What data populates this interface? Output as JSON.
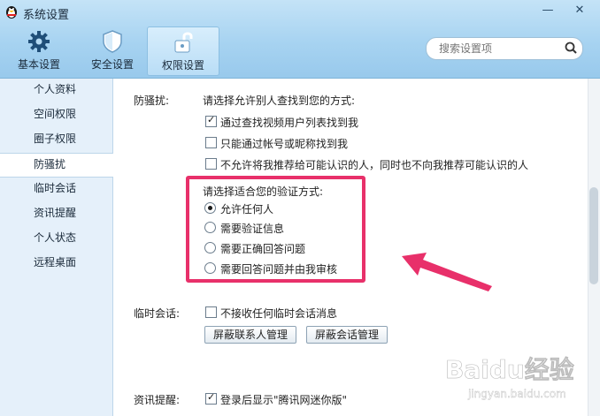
{
  "window": {
    "title": "系统设置"
  },
  "toolbar": {
    "tabs": [
      {
        "label": "基本设置",
        "icon": "gear-icon"
      },
      {
        "label": "安全设置",
        "icon": "shield-icon"
      },
      {
        "label": "权限设置",
        "icon": "unlock-icon",
        "active": true
      }
    ]
  },
  "search": {
    "placeholder": "搜索设置项"
  },
  "sidebar": {
    "items": [
      {
        "label": "个人资料"
      },
      {
        "label": "空间权限"
      },
      {
        "label": "圈子权限"
      },
      {
        "label": "防骚扰",
        "active": true
      },
      {
        "label": "临时会话"
      },
      {
        "label": "资讯提醒"
      },
      {
        "label": "个人状态"
      },
      {
        "label": "远程桌面"
      }
    ]
  },
  "anti_harass": {
    "label": "防骚扰:",
    "prompt": "请选择允许别人查找到您的方式:",
    "options": [
      {
        "label": "通过查找视频用户列表找到我",
        "checked": true
      },
      {
        "label": "只能通过帐号或昵称找到我",
        "checked": false
      },
      {
        "label": "不允许将我推荐给可能认识的人，同时也不向我推荐可能认识的人",
        "checked": false
      }
    ],
    "verify_prompt": "请选择适合您的验证方式:",
    "verify_options": [
      {
        "label": "允许任何人",
        "selected": true
      },
      {
        "label": "需要验证信息",
        "selected": false
      },
      {
        "label": "需要正确回答问题",
        "selected": false
      },
      {
        "label": "需要回答问题并由我审核",
        "selected": false
      }
    ]
  },
  "temp_session": {
    "label": "临时会话:",
    "option": {
      "label": "不接收任何临时会话消息",
      "checked": false
    },
    "buttons": [
      "屏蔽联系人管理",
      "屏蔽会话管理"
    ]
  },
  "news_reminder": {
    "label": "资讯提醒:",
    "option": {
      "label": "登录后显示\"腾讯网迷你版\"",
      "checked": true
    }
  },
  "watermark": {
    "text": "Baidu经验",
    "subtext": "jingyan.baidu.com"
  },
  "colors": {
    "highlight": "#e8306a",
    "sidebar_bg": "#e5f0fa",
    "toolbar_bg": "#a7d3f1"
  }
}
